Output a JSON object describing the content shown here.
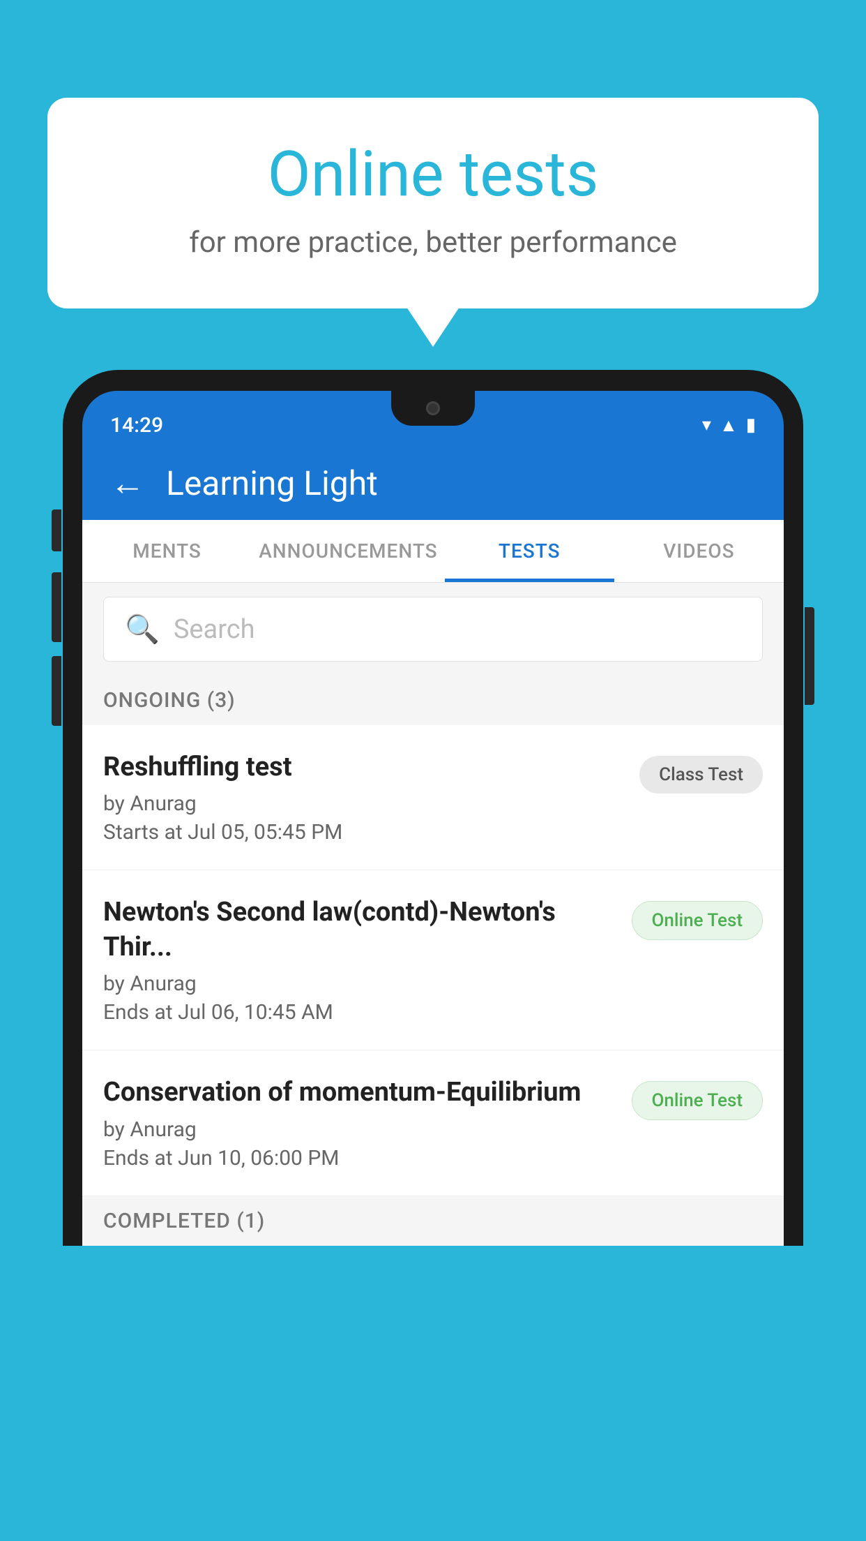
{
  "background": {
    "color": "#29b6d8"
  },
  "speech_bubble": {
    "title": "Online tests",
    "subtitle": "for more practice, better performance"
  },
  "phone": {
    "status_bar": {
      "time": "14:29",
      "icons": [
        "wifi",
        "signal",
        "battery"
      ]
    },
    "header": {
      "back_label": "←",
      "title": "Learning Light"
    },
    "tabs": [
      {
        "label": "MENTS",
        "active": false
      },
      {
        "label": "ANNOUNCEMENTS",
        "active": false
      },
      {
        "label": "TESTS",
        "active": true
      },
      {
        "label": "VIDEOS",
        "active": false
      }
    ],
    "search": {
      "placeholder": "Search"
    },
    "ongoing_section": {
      "label": "ONGOING (3)"
    },
    "test_items": [
      {
        "name": "Reshuffling test",
        "author": "by Anurag",
        "date": "Starts at  Jul 05, 05:45 PM",
        "badge": "Class Test",
        "badge_type": "class"
      },
      {
        "name": "Newton's Second law(contd)-Newton's Thir...",
        "author": "by Anurag",
        "date": "Ends at  Jul 06, 10:45 AM",
        "badge": "Online Test",
        "badge_type": "online"
      },
      {
        "name": "Conservation of momentum-Equilibrium",
        "author": "by Anurag",
        "date": "Ends at  Jun 10, 06:00 PM",
        "badge": "Online Test",
        "badge_type": "online"
      }
    ],
    "completed_section": {
      "label": "COMPLETED (1)"
    }
  }
}
